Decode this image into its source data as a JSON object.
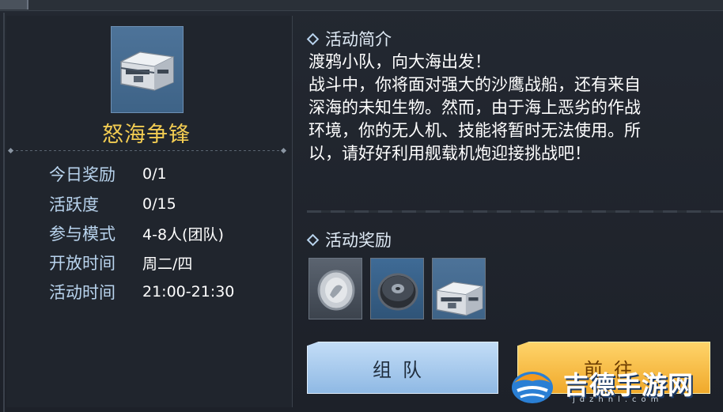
{
  "event": {
    "name": "怒海争锋",
    "info": [
      {
        "label": "今日奖励",
        "value": "0/1"
      },
      {
        "label": "活跃度",
        "value": "0/15"
      },
      {
        "label": "参与模式",
        "value": "4-8人(团队)"
      },
      {
        "label": "开放时间",
        "value": "周二/四"
      },
      {
        "label": "活动时间",
        "value": "21:00-21:30"
      }
    ]
  },
  "intro": {
    "title": "活动简介",
    "text": "渡鸦小队，向大海出发！\n战斗中，你将面对强大的沙鹰战船，还有来自\n深海的未知生物。然而，由于海上恶劣的作战\n环境，你的无人机、技能将暂时无法使用。所\n以，请好好利用舰载机炮迎接挑战吧！"
  },
  "rewards": {
    "title": "活动奖励",
    "items": [
      {
        "icon": "silver-coin-icon"
      },
      {
        "icon": "gear-part-icon"
      },
      {
        "icon": "supply-crate-icon"
      }
    ]
  },
  "buttons": {
    "team": "组队",
    "go": "前往"
  },
  "watermark": {
    "text": "吉德手游网",
    "sub": "jdzhnl.com"
  },
  "colors": {
    "event_name": "#f2cc52",
    "label": "#b9d4ee",
    "team_button": "#a9cbef",
    "go_button": "#f7bd42"
  }
}
